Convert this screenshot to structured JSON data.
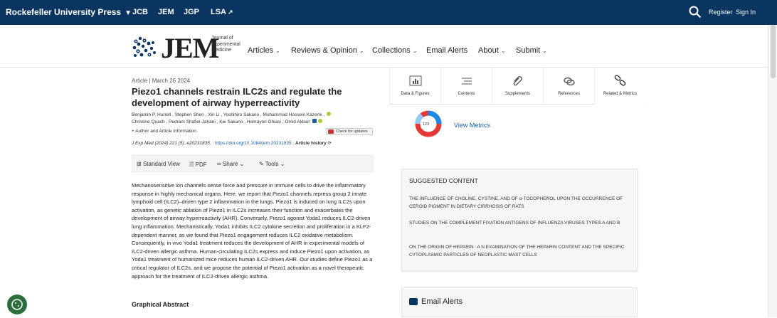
{
  "topbar": {
    "press": "Rockefeller University Press",
    "journals": [
      "JCB",
      "JEM",
      "JGP",
      "LSA"
    ],
    "register": "Register",
    "sign_in": "Sign In"
  },
  "masthead": {
    "logo_text": "JEM",
    "logo_sub": [
      "Journal of",
      "Experimental",
      "Medicine"
    ],
    "nav": [
      {
        "label": "Articles",
        "dropdown": true
      },
      {
        "label": "Reviews & Opinion",
        "dropdown": true
      },
      {
        "label": "Collections",
        "dropdown": true
      },
      {
        "label": "Email Alerts",
        "dropdown": false
      },
      {
        "label": "About",
        "dropdown": true
      },
      {
        "label": "Submit",
        "dropdown": true
      }
    ]
  },
  "article": {
    "type_line": "Article | March 26 2024",
    "title": "Piezo1 channels restrain ILC2s and regulate the development of airway hyperreactivity",
    "authors_line1": "Benjamin P. Hurrell , Stephen Shen , Xin Li , Yoshihiro Sakano , Mohammad Hossein Kazemi ,",
    "authors_line2": "Christine Quach , Pedram Shafiei-Jahani , Kei Sakano , Homayon Ghiasi , Omid Akbari",
    "author_info": "+ Author and Article Information",
    "check_updates": "Check for updates",
    "citation": "J Exp Med (2024) 221 (5): e20231835.",
    "doi": "https://doi.org/10.1084/jem.20231835",
    "history": "Article history",
    "abstract": "Mechanosensitive ion channels sense force and pressure in immune cells to drive the inflammatory response in highly mechanical organs. Here, we report that Piezo1 channels repress group 2 innate lymphoid cell (ILC2)–driven type 2 inflammation in the lungs. Piezo1 is induced on lung ILC2s upon activation, as genetic ablation of Piezo1 in ILC2s increases their function and exacerbates the development of airway hyperreactivity (AHR). Conversely, Piezo1 agonist Yoda1 reduces ILC2-driven lung inflammation. Mechanistically, Yoda1 inhibits ILC2 cytokine secretion and proliferation in a KLF2-dependent manner, as we found that Piezo1 engagement reduces ILC2 oxidative metabolism. Consequently, in vivo Yoda1 treatment reduces the development of AHR in experimental models of ILC2-driven allergic asthma. Human-circulating ILC2s express and induce Piezo1 upon activation, as Yoda1 treatment of humanized mice reduces human ILC2-driven AHR. Our studies define Piezo1 as a critical regulator of ILC2s, and we propose the potential of Piezo1 activation as a novel therapeutic approach for the treatment of ILC2-driven allergic asthma.",
    "graphical_abstract": "Graphical Abstract"
  },
  "toolbar": {
    "standard_view": "Standard View",
    "pdf": "PDF",
    "share": "Share",
    "tools": "Tools"
  },
  "side_tabs": [
    {
      "label": "Data & Figures",
      "icon": "chart-icon"
    },
    {
      "label": "Contents",
      "icon": "list-icon"
    },
    {
      "label": "Supplements",
      "icon": "paperclip-icon"
    },
    {
      "label": "References",
      "icon": "link-icon"
    },
    {
      "label": "Related & Metrics",
      "icon": "chain-icon"
    }
  ],
  "metrics": {
    "count": "123",
    "label": "View Metrics"
  },
  "suggested": {
    "heading": "SUGGESTED CONTENT",
    "items": [
      "THE INFLUENCE OF CHOLINE, CYSTINE, AND OF α-TOCOPHEROL UPON THE OCCURRENCE OF CEROID PIGMENT IN DIETARY CIRRHOSIS OF RATS",
      "STUDIES ON THE COMPLEMENT FIXATION ANTIGENS OF INFLUENZA VIRUSES TYPES A AND B",
      "ON THE ORIGIN OF HEPARIN : A N EXAMINATION OF THE HEPARIN CONTENT AND THE SPECIFIC CYTOPLASMIC PARTICLES OF NEOPLASTIC MAST CELLS"
    ]
  },
  "email_alerts": "Email Alerts",
  "colors": {
    "topbar": "#0a3560",
    "link": "#1d5fa0",
    "orcid": "#a6ce39"
  }
}
